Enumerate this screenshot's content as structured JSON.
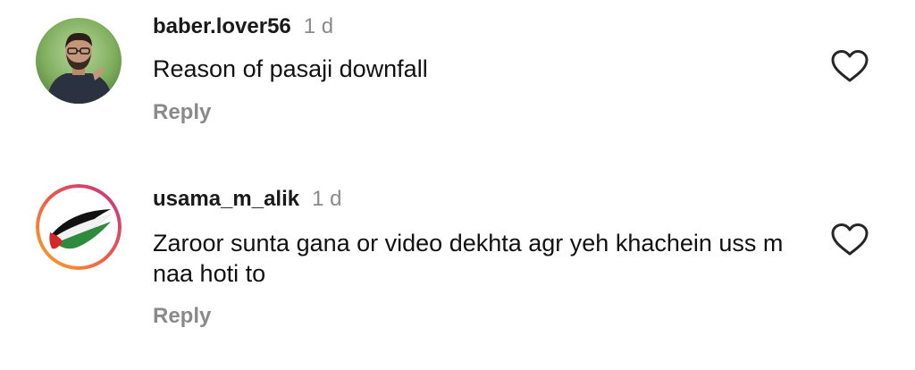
{
  "comments": [
    {
      "username": "baber.lover56",
      "time": "1 d",
      "text": "Reason of pasaji downfall",
      "reply_label": "Reply",
      "avatar_icon": "profile-photo",
      "like_icon": "heart-outline-icon"
    },
    {
      "username": "usama_m_alik",
      "time": "1 d",
      "text": "Zaroor sunta gana or video dekhta agr yeh khachein uss m naa hoti to",
      "reply_label": "Reply",
      "avatar_icon": "palestine-flag-brush",
      "like_icon": "heart-outline-icon"
    }
  ],
  "colors": {
    "text": "#111111",
    "muted": "#8a8a8a",
    "story_ring_start": "#f9a825",
    "story_ring_end": "#c13584"
  }
}
